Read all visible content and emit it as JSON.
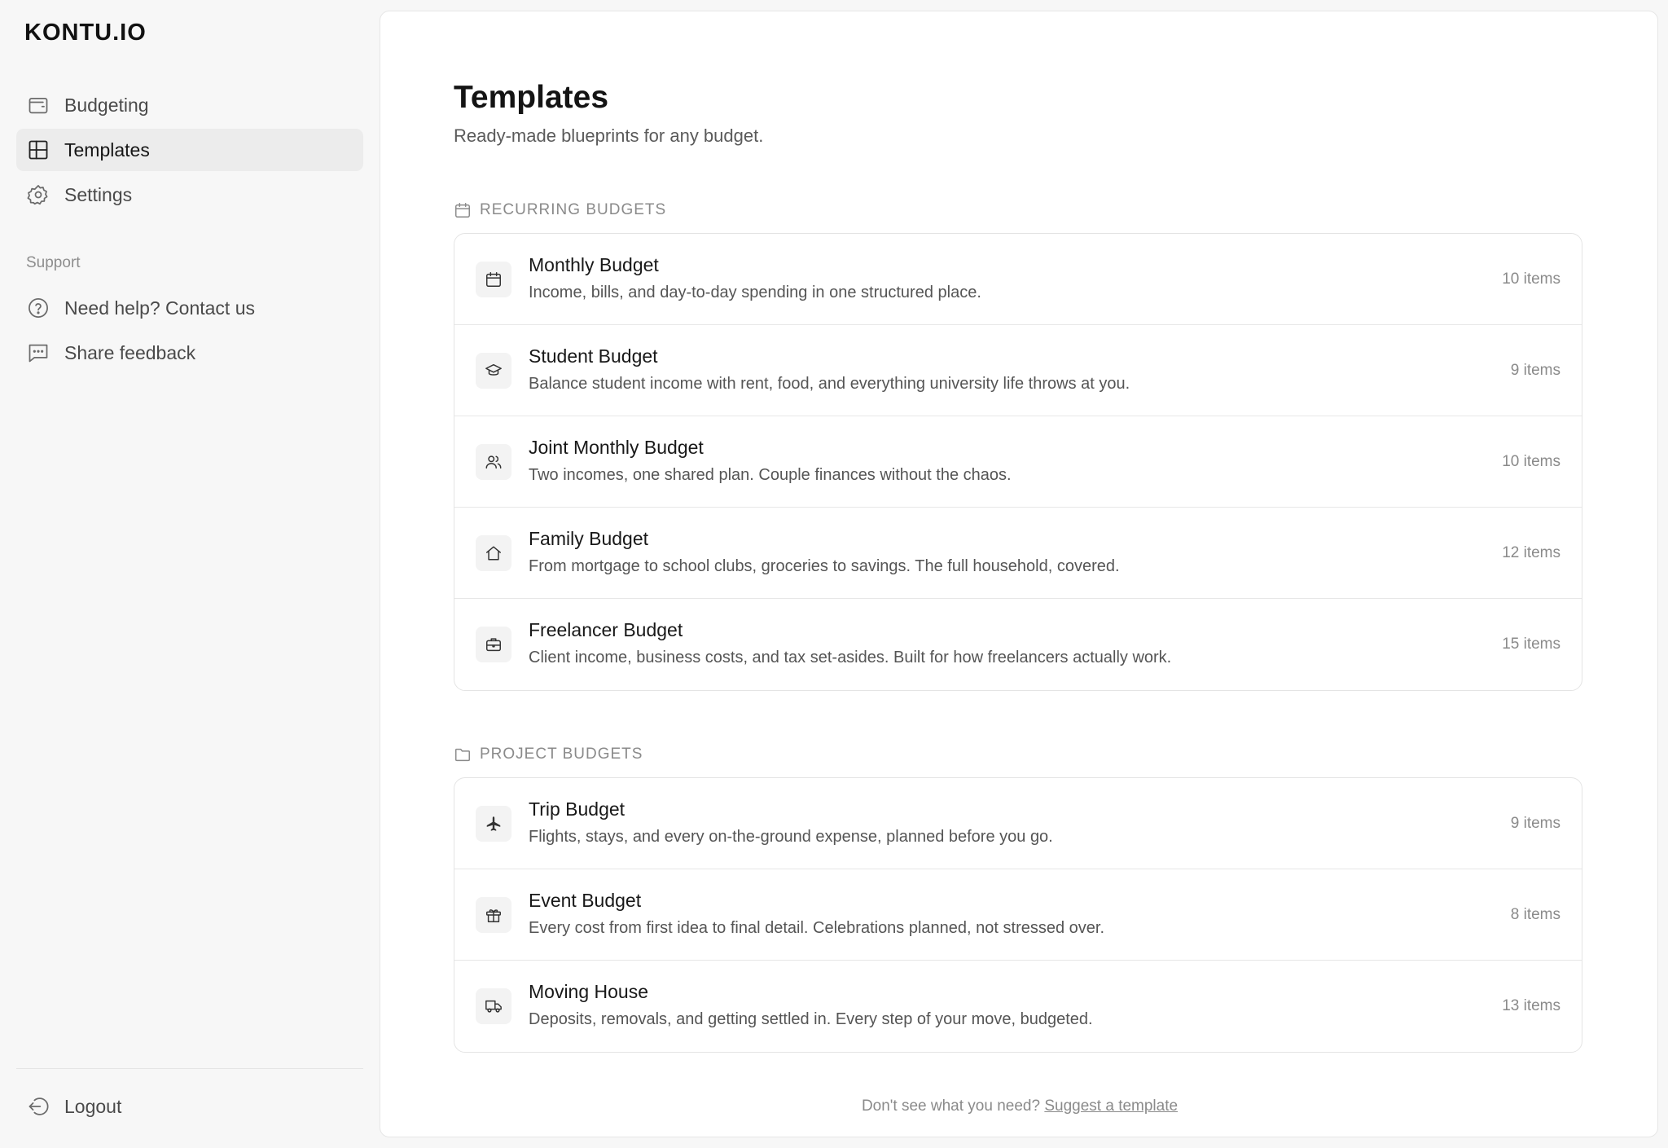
{
  "app": {
    "logo": "KONTU.IO"
  },
  "sidebar": {
    "items": [
      {
        "label": "Budgeting",
        "icon": "wallet-icon"
      },
      {
        "label": "Templates",
        "icon": "grid-icon",
        "active": true
      },
      {
        "label": "Settings",
        "icon": "gear-icon"
      }
    ],
    "support_heading": "Support",
    "support_items": [
      {
        "label": "Need help? Contact us",
        "icon": "help-circle-icon"
      },
      {
        "label": "Share feedback",
        "icon": "message-icon"
      }
    ],
    "logout_label": "Logout"
  },
  "main": {
    "title": "Templates",
    "subtitle": "Ready-made blueprints for any budget.",
    "sections": [
      {
        "heading": "RECURRING BUDGETS",
        "icon": "calendar-icon",
        "templates": [
          {
            "title": "Monthly Budget",
            "description": "Income, bills, and day-to-day spending in one structured place.",
            "count": "10 items",
            "icon": "calendar-icon"
          },
          {
            "title": "Student Budget",
            "description": "Balance student income with rent, food, and everything university life throws at you.",
            "count": "9 items",
            "icon": "graduation-cap-icon"
          },
          {
            "title": "Joint Monthly Budget",
            "description": "Two incomes, one shared plan. Couple finances without the chaos.",
            "count": "10 items",
            "icon": "users-icon"
          },
          {
            "title": "Family Budget",
            "description": "From mortgage to school clubs, groceries to savings. The full household, covered.",
            "count": "12 items",
            "icon": "house-icon"
          },
          {
            "title": "Freelancer Budget",
            "description": "Client income, business costs, and tax set-asides. Built for how freelancers actually work.",
            "count": "15 items",
            "icon": "briefcase-icon"
          }
        ]
      },
      {
        "heading": "PROJECT BUDGETS",
        "icon": "folder-icon",
        "templates": [
          {
            "title": "Trip Budget",
            "description": "Flights, stays, and every on-the-ground expense, planned before you go.",
            "count": "9 items",
            "icon": "plane-icon"
          },
          {
            "title": "Event Budget",
            "description": "Every cost from first idea to final detail. Celebrations planned, not stressed over.",
            "count": "8 items",
            "icon": "gift-icon"
          },
          {
            "title": "Moving House",
            "description": "Deposits, removals, and getting settled in. Every step of your move, budgeted.",
            "count": "13 items",
            "icon": "truck-icon"
          }
        ]
      }
    ],
    "footer_text": "Don't see what you need?",
    "footer_link": "Suggest a template"
  }
}
